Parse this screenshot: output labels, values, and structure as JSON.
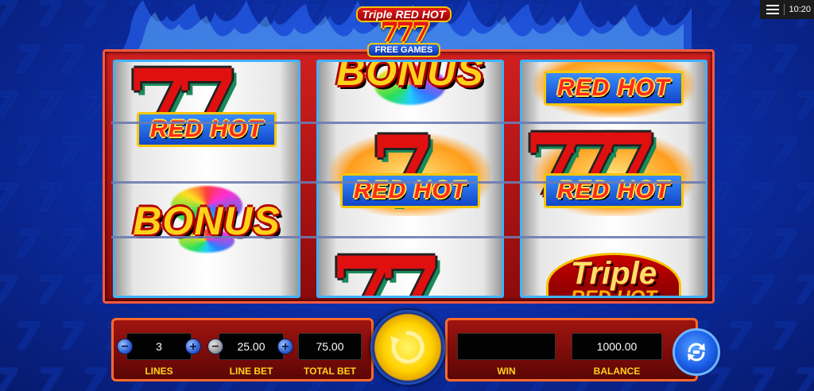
{
  "status": {
    "time": "10:20"
  },
  "logo": {
    "line1": "Triple RED HOT",
    "sevens": "777",
    "line3": "FREE GAMES"
  },
  "reels": {
    "reel1": {
      "top": "RED HOT",
      "middle": "BONUS"
    },
    "reel2": {
      "top": "BONUS",
      "middle": "RED HOT"
    },
    "reel3": {
      "top": "RED HOT",
      "middle": "RED HOT",
      "bottom": "Triple",
      "bottom_sub": "RED HOT"
    }
  },
  "controls": {
    "lines": {
      "value": "3",
      "label": "LINES"
    },
    "line_bet": {
      "value": "25.00",
      "label": "LINE BET"
    },
    "total_bet": {
      "value": "75.00",
      "label": "TOTAL BET"
    },
    "win": {
      "value": "",
      "label": "WIN"
    },
    "balance": {
      "value": "1000.00",
      "label": "BALANCE"
    },
    "minus_symbol": "−",
    "plus_symbol": "+"
  },
  "colors": {
    "accent_red": "#d11f1f",
    "accent_gold": "#ffd21a",
    "accent_blue": "#1a4bd6"
  },
  "icons": {
    "menu": "hamburger-menu-icon",
    "spin": "spin-arrow-icon",
    "autoplay": "autoplay-icon"
  }
}
